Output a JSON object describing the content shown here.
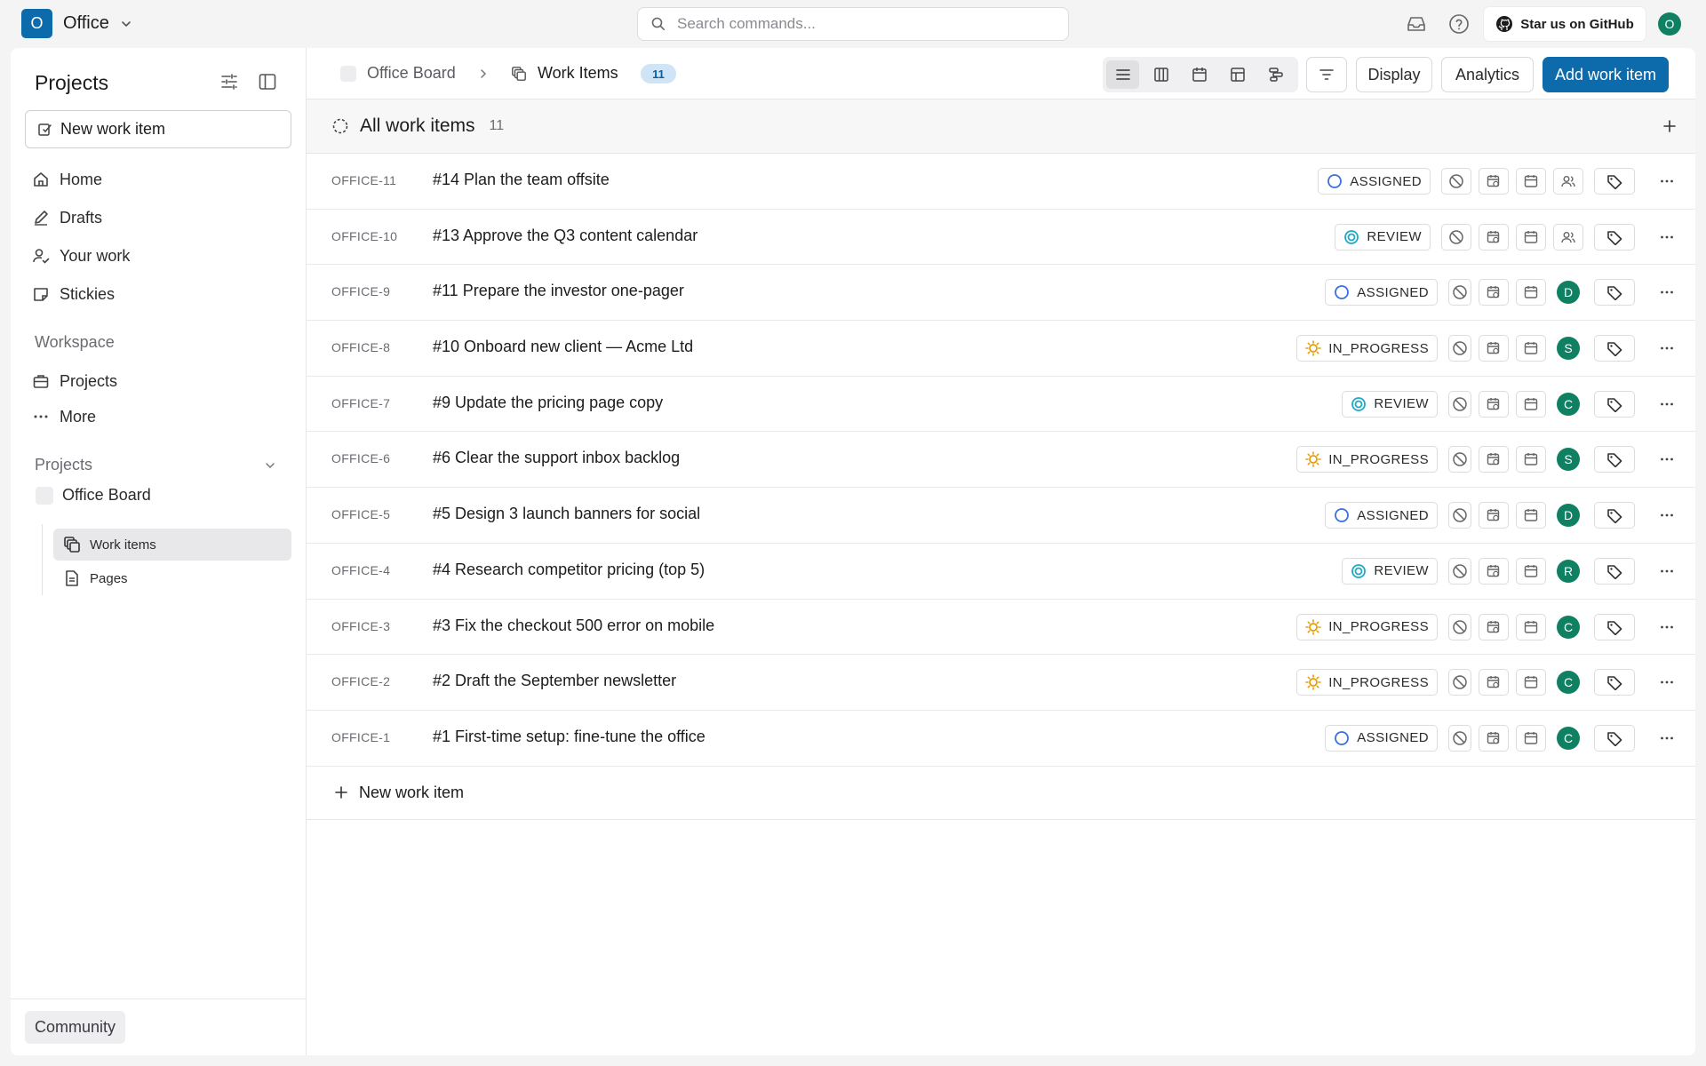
{
  "workspace": {
    "initial": "O",
    "name": "Office"
  },
  "search": {
    "placeholder": "Search commands..."
  },
  "topbar": {
    "github_label": "Star us on GitHub",
    "user_initial": "O"
  },
  "sidebar": {
    "title": "Projects",
    "new_item_label": "New work item",
    "nav": [
      {
        "label": "Home",
        "icon": "home-icon"
      },
      {
        "label": "Drafts",
        "icon": "pencil-icon"
      },
      {
        "label": "Your work",
        "icon": "user-check-icon"
      },
      {
        "label": "Stickies",
        "icon": "sticky-note-icon"
      }
    ],
    "workspace_label": "Workspace",
    "workspace_items": [
      {
        "label": "Projects",
        "icon": "briefcase-icon"
      },
      {
        "label": "More",
        "icon": "ellipsis-icon"
      }
    ],
    "projects_label": "Projects",
    "project_name": "Office Board",
    "project_children": [
      {
        "label": "Work items",
        "icon": "layers-icon",
        "active": true
      },
      {
        "label": "Pages",
        "icon": "page-icon",
        "active": false
      }
    ],
    "footer": {
      "community_label": "Community"
    }
  },
  "header": {
    "breadcrumb_project": "Office Board",
    "breadcrumb_current": "Work Items",
    "count": "11",
    "display_label": "Display",
    "analytics_label": "Analytics",
    "add_label": "Add work item",
    "layouts": [
      "list-layout-icon",
      "kanban-layout-icon",
      "calendar-layout-icon",
      "spreadsheet-layout-icon",
      "gantt-layout-icon"
    ]
  },
  "group": {
    "title": "All work items",
    "count": "11"
  },
  "colors": {
    "primary": "#0d6aab",
    "assigned": "#3b6fe0",
    "review": "#20a8c4",
    "in_progress": "#e3a008",
    "avatar": "#0f8061"
  },
  "work_items": [
    {
      "id": "OFFICE-11",
      "title": "#14 Plan the team offsite",
      "state": "ASSIGNED",
      "assignee": ""
    },
    {
      "id": "OFFICE-10",
      "title": "#13 Approve the Q3 content calendar",
      "state": "REVIEW",
      "assignee": ""
    },
    {
      "id": "OFFICE-9",
      "title": "#11 Prepare the investor one-pager",
      "state": "ASSIGNED",
      "assignee": "D"
    },
    {
      "id": "OFFICE-8",
      "title": "#10 Onboard new client — Acme Ltd",
      "state": "IN_PROGRESS",
      "assignee": "S"
    },
    {
      "id": "OFFICE-7",
      "title": "#9 Update the pricing page copy",
      "state": "REVIEW",
      "assignee": "C"
    },
    {
      "id": "OFFICE-6",
      "title": "#6 Clear the support inbox backlog",
      "state": "IN_PROGRESS",
      "assignee": "S"
    },
    {
      "id": "OFFICE-5",
      "title": "#5 Design 3 launch banners for social",
      "state": "ASSIGNED",
      "assignee": "D"
    },
    {
      "id": "OFFICE-4",
      "title": "#4 Research competitor pricing (top 5)",
      "state": "REVIEW",
      "assignee": "R"
    },
    {
      "id": "OFFICE-3",
      "title": "#3 Fix the checkout 500 error on mobile",
      "state": "IN_PROGRESS",
      "assignee": "C"
    },
    {
      "id": "OFFICE-2",
      "title": "#2 Draft the September newsletter",
      "state": "IN_PROGRESS",
      "assignee": "C"
    },
    {
      "id": "OFFICE-1",
      "title": "#1 First-time setup: fine-tune the office",
      "state": "ASSIGNED",
      "assignee": "C"
    }
  ],
  "new_row_label": "New work item"
}
